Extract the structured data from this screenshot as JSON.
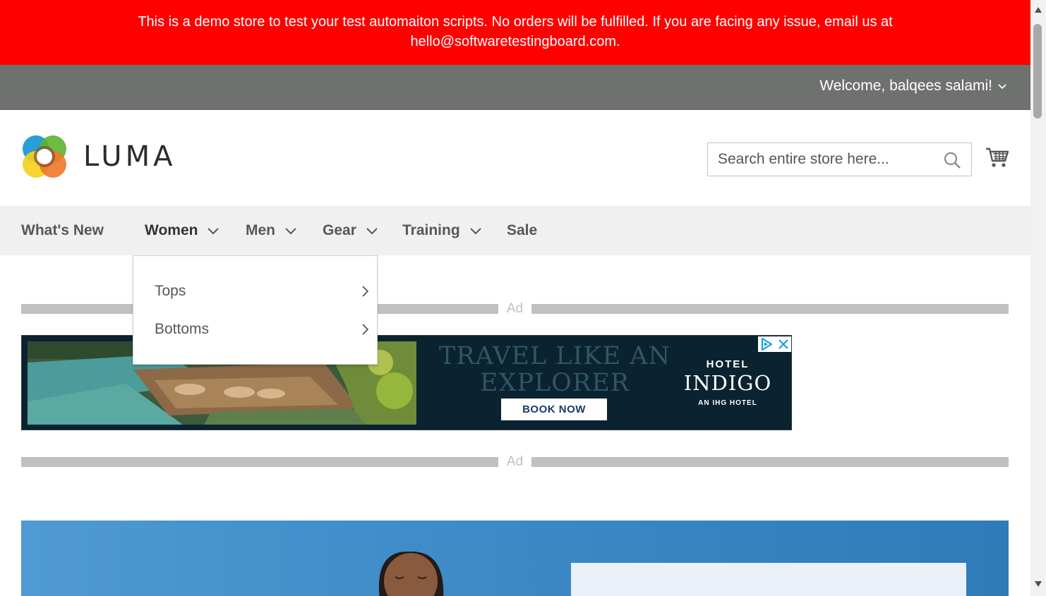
{
  "demo_notice": {
    "text": "This is a demo store to test your test automaiton scripts. No orders will be fulfilled. If you are facing any issue, email us at hello@softwaretestingboard.com."
  },
  "header": {
    "welcome": "Welcome, balqees salami!",
    "logo_text": "LUMA",
    "search_placeholder": "Search entire store here...",
    "search_value": ""
  },
  "nav": {
    "items": [
      {
        "label": "What's New",
        "has_dropdown": false
      },
      {
        "label": "Women",
        "has_dropdown": true,
        "active": true
      },
      {
        "label": "Men",
        "has_dropdown": true
      },
      {
        "label": "Gear",
        "has_dropdown": true
      },
      {
        "label": "Training",
        "has_dropdown": true
      },
      {
        "label": "Sale",
        "has_dropdown": false
      }
    ]
  },
  "women_submenu": {
    "items": [
      {
        "label": "Tops"
      },
      {
        "label": "Bottoms"
      }
    ]
  },
  "ads": {
    "label": "Ad",
    "headline_line1": "TRAVEL LIKE AN",
    "headline_line2": "EXPLORER",
    "cta": "BOOK NOW",
    "brand_top": "HOTEL",
    "brand": "INDIGO",
    "brand_sub": "AN IHG HOTEL"
  },
  "colors": {
    "banner_red": "#ff0000",
    "panel_gray": "#6e716e",
    "nav_bg": "#f0f0f0",
    "ad_bg": "#0b2230"
  },
  "icons": [
    "chevron-down-icon",
    "search-icon",
    "cart-icon",
    "chevron-right-icon",
    "adchoices-icon",
    "close-icon"
  ]
}
